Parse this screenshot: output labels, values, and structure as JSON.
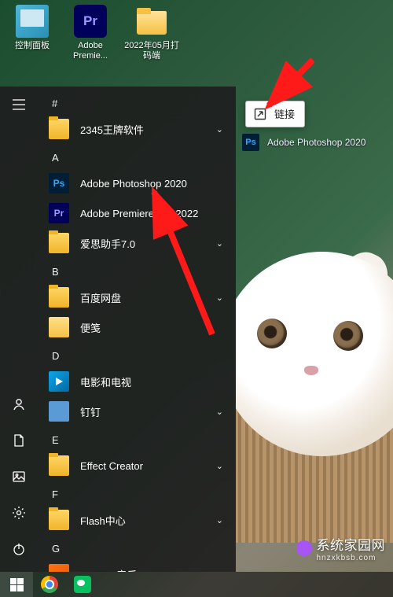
{
  "desktop": {
    "icons": [
      {
        "label": "控制面板"
      },
      {
        "label": "Adobe Premie...",
        "badge": "Pr"
      },
      {
        "label": "2022年05月打码端"
      }
    ]
  },
  "start": {
    "header_letter": "#",
    "groups": [
      {
        "letter": "#",
        "items": [
          {
            "label": "2345王牌软件",
            "icon": "folder",
            "expandable": true
          }
        ]
      },
      {
        "letter": "A",
        "items": [
          {
            "label": "Adobe Photoshop 2020",
            "icon": "ps",
            "expandable": false
          },
          {
            "label": "Adobe Premiere Pro 2022",
            "icon": "pr",
            "expandable": false
          },
          {
            "label": "爱思助手7.0",
            "icon": "folder",
            "expandable": true
          }
        ]
      },
      {
        "letter": "B",
        "items": [
          {
            "label": "百度网盘",
            "icon": "folder",
            "expandable": true
          },
          {
            "label": "便笺",
            "icon": "note",
            "expandable": false
          }
        ]
      },
      {
        "letter": "D",
        "items": [
          {
            "label": "电影和电视",
            "icon": "tv",
            "expandable": false
          },
          {
            "label": "钉钉",
            "icon": "ding",
            "expandable": true
          }
        ]
      },
      {
        "letter": "E",
        "items": [
          {
            "label": "Effect Creator",
            "icon": "folder",
            "expandable": true
          }
        ]
      },
      {
        "letter": "F",
        "items": [
          {
            "label": "Flash中心",
            "icon": "folder",
            "expandable": true
          }
        ]
      },
      {
        "letter": "G",
        "items": [
          {
            "label": "Groove 音乐",
            "icon": "groove",
            "expandable": false
          }
        ]
      }
    ]
  },
  "drag": {
    "label": "Adobe Photoshop 2020",
    "badge": "Ps"
  },
  "tooltip": {
    "label": "链接"
  },
  "watermark": {
    "brand": "系统家园网",
    "url": "hnzxkbsb.com"
  }
}
